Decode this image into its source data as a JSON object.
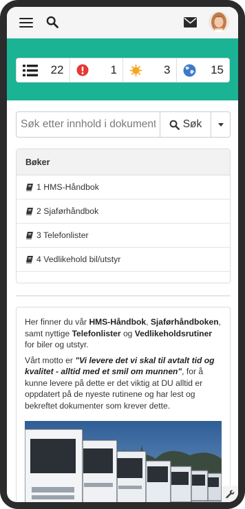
{
  "header": {
    "menu_icon": "hamburger-icon",
    "search_icon": "search-icon",
    "mail_icon": "envelope-icon",
    "avatar": "user-avatar"
  },
  "stats": [
    {
      "icon": "list-icon",
      "value": "22",
      "color": "#222222"
    },
    {
      "icon": "exclamation-circle-icon",
      "value": "1",
      "color": "#e53935"
    },
    {
      "icon": "sun-icon",
      "value": "3",
      "color": "#f6a623"
    },
    {
      "icon": "globe-icon",
      "value": "15",
      "color": "#3d7ac7"
    }
  ],
  "search": {
    "placeholder": "Søk etter innhold i dokumenter",
    "button_label": "Søk"
  },
  "books": {
    "title": "Bøker",
    "items": [
      {
        "label": "1 HMS-Håndbok"
      },
      {
        "label": "2 Sjaførhåndbok"
      },
      {
        "label": "3 Telefonlister"
      },
      {
        "label": "4 Vedlikehold bil/utstyr"
      }
    ]
  },
  "info": {
    "p1": {
      "t1": "Her finner du vår ",
      "b1": "HMS-Håndbok",
      "t2": ", ",
      "b2": "Sjaførhåndboken",
      "t3": ", samt nyttige ",
      "b3": "Telefonlister",
      "t4": " og ",
      "b4": "Vedlikeholdsrutiner",
      "t5": " for biler og utstyr."
    },
    "p2": {
      "t1": "Vårt motto er ",
      "b1": "\"Vi levere det vi skal til avtalt tid og kvalitet - alltid med et smil om munnen\"",
      "t2": ", for å kunne levere på dette er det viktig at DU alltid er oppdatert på de nyeste rutinene og har lest og bekreftet dokumenter som krever dette."
    },
    "image": "trucks-photo"
  },
  "colors": {
    "brand_green": "#1ab394"
  }
}
